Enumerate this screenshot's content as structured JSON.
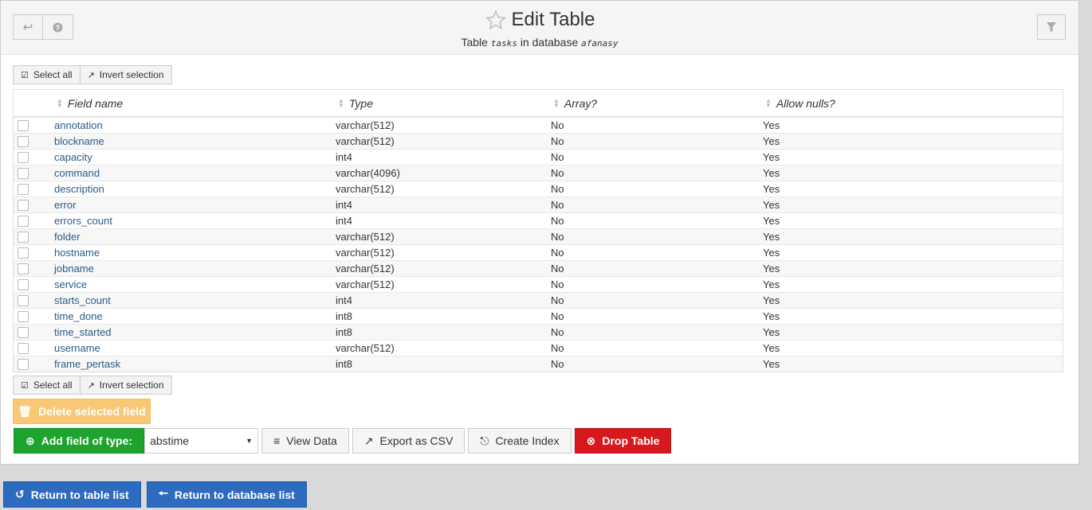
{
  "header": {
    "title": "Edit Table",
    "subtitle_prefix": "Table",
    "table_name": "tasks",
    "subtitle_mid": "in database",
    "database_name": "afanasy"
  },
  "selection": {
    "select_all": "Select all",
    "invert": "Invert selection"
  },
  "table": {
    "columns": [
      "Field name",
      "Type",
      "Array?",
      "Allow nulls?"
    ],
    "rows": [
      {
        "name": "annotation",
        "type": "varchar(512)",
        "array": "No",
        "nulls": "Yes"
      },
      {
        "name": "blockname",
        "type": "varchar(512)",
        "array": "No",
        "nulls": "Yes"
      },
      {
        "name": "capacity",
        "type": "int4",
        "array": "No",
        "nulls": "Yes"
      },
      {
        "name": "command",
        "type": "varchar(4096)",
        "array": "No",
        "nulls": "Yes"
      },
      {
        "name": "description",
        "type": "varchar(512)",
        "array": "No",
        "nulls": "Yes"
      },
      {
        "name": "error",
        "type": "int4",
        "array": "No",
        "nulls": "Yes"
      },
      {
        "name": "errors_count",
        "type": "int4",
        "array": "No",
        "nulls": "Yes"
      },
      {
        "name": "folder",
        "type": "varchar(512)",
        "array": "No",
        "nulls": "Yes"
      },
      {
        "name": "hostname",
        "type": "varchar(512)",
        "array": "No",
        "nulls": "Yes"
      },
      {
        "name": "jobname",
        "type": "varchar(512)",
        "array": "No",
        "nulls": "Yes"
      },
      {
        "name": "service",
        "type": "varchar(512)",
        "array": "No",
        "nulls": "Yes"
      },
      {
        "name": "starts_count",
        "type": "int4",
        "array": "No",
        "nulls": "Yes"
      },
      {
        "name": "time_done",
        "type": "int8",
        "array": "No",
        "nulls": "Yes"
      },
      {
        "name": "time_started",
        "type": "int8",
        "array": "No",
        "nulls": "Yes"
      },
      {
        "name": "username",
        "type": "varchar(512)",
        "array": "No",
        "nulls": "Yes"
      },
      {
        "name": "frame_pertask",
        "type": "int8",
        "array": "No",
        "nulls": "Yes"
      }
    ]
  },
  "actions": {
    "delete_label": "Delete selected field",
    "add_field_label": "Add field of type:",
    "field_type_value": "abstime",
    "view_data": "View Data",
    "export_csv": "Export as CSV",
    "create_index": "Create Index",
    "drop_table": "Drop Table"
  },
  "bottom": {
    "return_table_list": "Return to table list",
    "return_database_list": "Return to database list"
  },
  "colors": {
    "link": "#2a5a8a",
    "green": "#1ea32f",
    "red": "#d7181e",
    "blue": "#2d6bbf",
    "warning": "#f9c874"
  }
}
